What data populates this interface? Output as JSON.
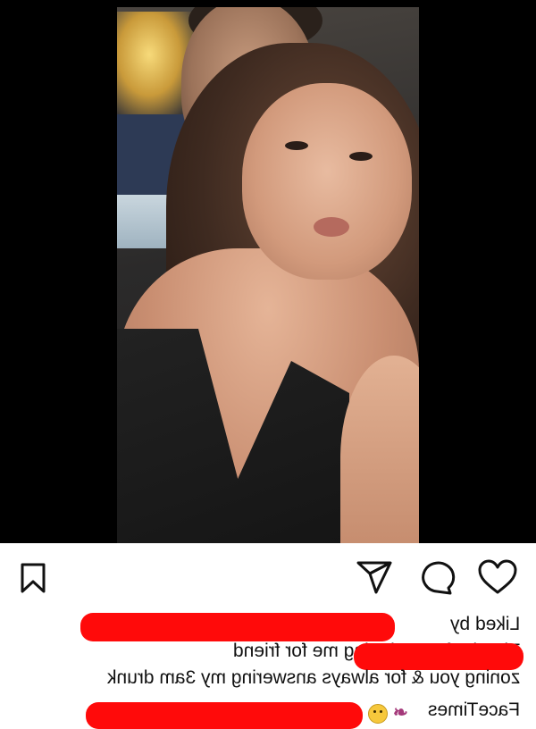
{
  "post": {
    "image_alt": "",
    "actions": {
      "bookmark": "bookmark-icon",
      "share": "share-icon",
      "comment": "comment-icon",
      "like": "heart-icon"
    },
    "caption": {
      "liked_by": "Liked by",
      "line2": "Thanks for not hating me for friend",
      "line3": "zoning you & for always answering my 3am drunk",
      "line4": "FaceTimes"
    },
    "emojis": [
      "ribbon",
      "smiley-face"
    ]
  },
  "colors": {
    "redaction": "#ff0a0a",
    "frame": "#000000",
    "background": "#ffffff"
  }
}
